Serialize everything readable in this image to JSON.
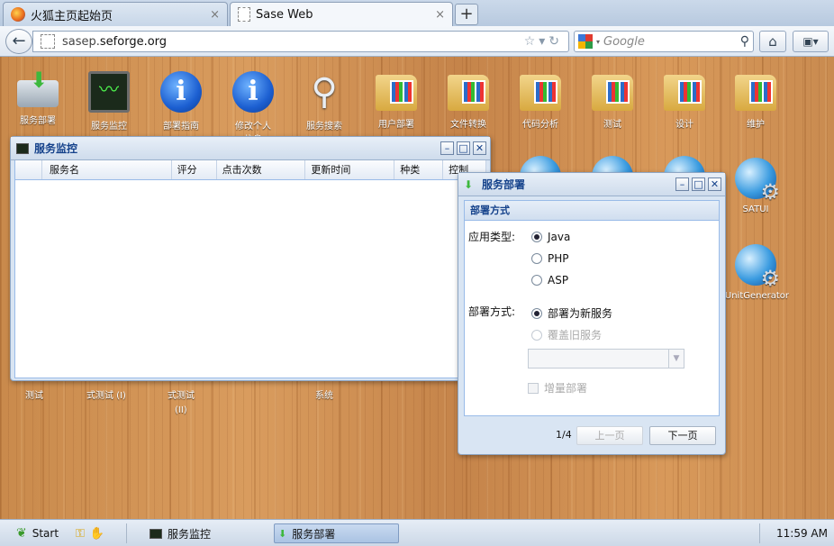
{
  "browser": {
    "tabs": [
      {
        "title": "火狐主页起始页",
        "close": "×"
      },
      {
        "title": "Sase Web",
        "close": "×"
      }
    ],
    "new_tab": "+",
    "url_host": "sasep.",
    "url_domain": "seforge.org",
    "search_placeholder": "Google"
  },
  "desktop": {
    "icons_row1": [
      {
        "label": "服务部署",
        "icon": "deploy-icon"
      },
      {
        "label": "服务监控",
        "icon": "monitor-icon"
      },
      {
        "label": "部署指南",
        "icon": "info-icon"
      },
      {
        "label": "修改个人",
        "label2": "信息",
        "icon": "info-icon"
      },
      {
        "label": "服务搜索",
        "icon": "search-icon"
      },
      {
        "label": "用户部署",
        "icon": "folder-icon"
      },
      {
        "label": "文件转换",
        "icon": "folder-icon"
      },
      {
        "label": "代码分析",
        "icon": "folder-icon"
      },
      {
        "label": "测试",
        "icon": "folder-icon"
      },
      {
        "label": "设计",
        "icon": "folder-icon"
      },
      {
        "label": "维护",
        "icon": "folder-icon"
      }
    ],
    "icons_right": [
      {
        "label": "SATUI",
        "icon": "globe-gear-icon"
      },
      {
        "label": "JUnitGenerator",
        "icon": "globe-gear-icon"
      }
    ],
    "partial_labels": [
      "测试",
      "式测试 (I)",
      "式测试",
      "(II)",
      "系统"
    ]
  },
  "monitor_window": {
    "title": "服务监控",
    "columns": [
      "",
      "服务名",
      "评分",
      "点击次数",
      "更新时间",
      "种类",
      "控制"
    ]
  },
  "deploy_window": {
    "title": "服务部署",
    "section": "部署方式",
    "app_type_label": "应用类型:",
    "app_types": [
      "Java",
      "PHP",
      "ASP"
    ],
    "selected_app_type": "Java",
    "deploy_mode_label": "部署方式:",
    "deploy_modes": [
      "部署为新服务",
      "覆盖旧服务"
    ],
    "selected_mode": "部署为新服务",
    "incremental_label": "增量部署",
    "page": "1/4",
    "prev": "上一页",
    "next": "下一页"
  },
  "taskbar": {
    "start": "Start",
    "items": [
      "服务监控",
      "服务部署"
    ],
    "clock": "11:59 AM"
  }
}
